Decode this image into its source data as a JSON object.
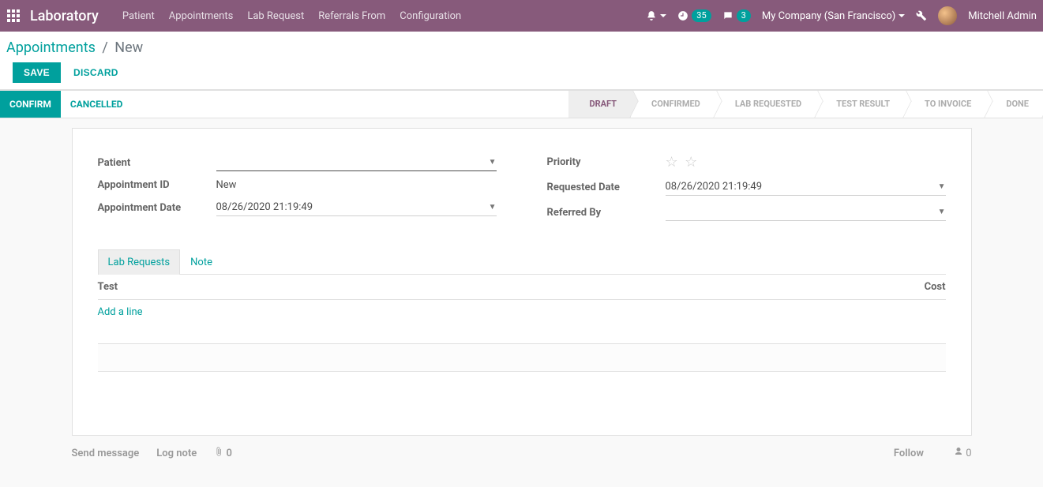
{
  "topnav": {
    "brand": "Laboratory",
    "menu": [
      "Patient",
      "Appointments",
      "Lab Request",
      "Referrals From",
      "Configuration"
    ],
    "activity_badge": "35",
    "message_badge": "3",
    "company": "My Company (San Francisco)",
    "user": "Mitchell Admin"
  },
  "breadcrumb": {
    "parent": "Appointments",
    "current": "New"
  },
  "actions": {
    "save": "SAVE",
    "discard": "DISCARD"
  },
  "status_buttons": {
    "confirm": "CONFIRM",
    "cancelled": "CANCELLED"
  },
  "status_steps": [
    "DRAFT",
    "CONFIRMED",
    "LAB REQUESTED",
    "TEST RESULT",
    "TO INVOICE",
    "DONE"
  ],
  "form": {
    "labels": {
      "patient": "Patient",
      "appointment_id": "Appointment ID",
      "appointment_date": "Appointment Date",
      "priority": "Priority",
      "requested_date": "Requested Date",
      "referred_by": "Referred By"
    },
    "values": {
      "patient": "",
      "appointment_id": "New",
      "appointment_date": "08/26/2020 21:19:49",
      "requested_date": "08/26/2020 21:19:49",
      "referred_by": ""
    }
  },
  "tabs": {
    "lab_requests": "Lab Requests",
    "note": "Note"
  },
  "table": {
    "col_test": "Test",
    "col_cost": "Cost",
    "add_line": "Add a line"
  },
  "chatter": {
    "send_message": "Send message",
    "log_note": "Log note",
    "attachments": "0",
    "follow": "Follow",
    "followers": "0"
  }
}
